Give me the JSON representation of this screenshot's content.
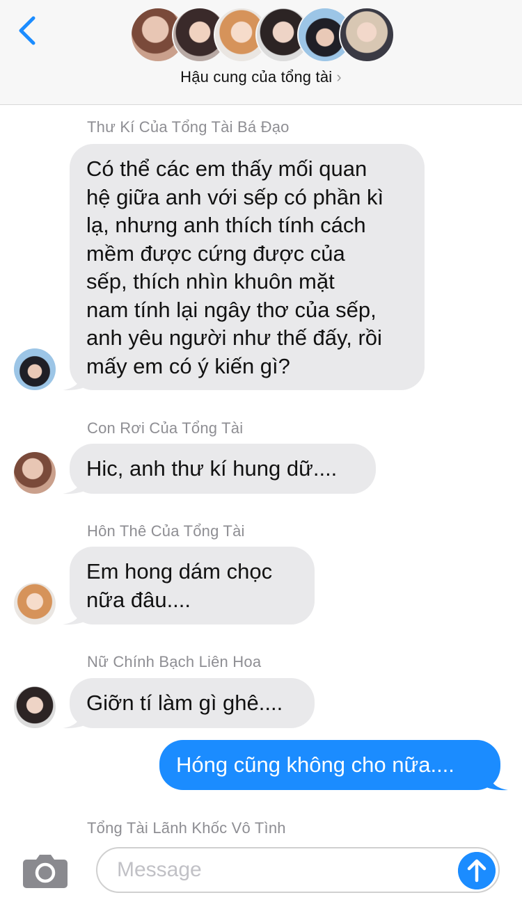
{
  "header": {
    "group_name": "Hậu cung của tổng tài",
    "chevron": "›"
  },
  "messages": [
    {
      "sender": "Thư Kí Của Tổng Tài Bá Đạo",
      "lines": [
        "Có thể các em thấy mối quan",
        "hệ giữa anh với sếp có phần kì",
        "lạ, nhưng anh thích tính cách",
        "mềm được cứng được của",
        "sếp, thích nhìn khuôn mặt",
        "nam tính lại ngây thơ của sếp,",
        "anh yêu người như thế đấy, rồi",
        "mấy em có ý kiến gì?"
      ]
    },
    {
      "sender": "Con Rơi Của Tổng Tài",
      "lines": [
        "Hic, anh thư kí hung dữ...."
      ]
    },
    {
      "sender": "Hôn Thê Của Tổng Tài",
      "lines": [
        "Em hong dám chọc",
        "nữa đâu...."
      ]
    },
    {
      "sender": "Nữ Chính Bạch Liên Hoa",
      "lines": [
        "Giỡn tí làm gì ghê...."
      ]
    },
    {
      "sender": "",
      "lines": [
        "Hóng cũng không cho nữa...."
      ]
    },
    {
      "sender": "Tổng Tài Lãnh Khốc Vô Tình",
      "lines": []
    }
  ],
  "composer": {
    "placeholder": "Message"
  },
  "colors": {
    "accent": "#1b8cff",
    "bubble_gray": "#e9e9eb",
    "sender_gray": "#8e8e93"
  },
  "icons": [
    "back-chevron-icon",
    "camera-icon",
    "send-arrow-icon"
  ]
}
